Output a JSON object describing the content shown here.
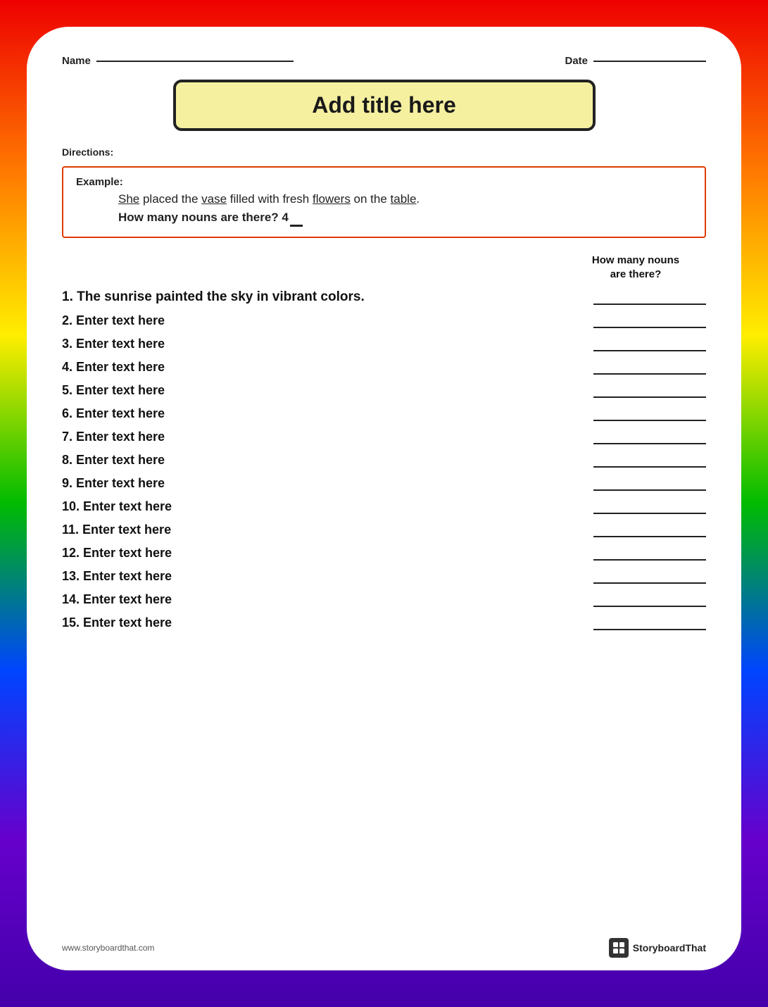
{
  "page": {
    "rainbow_colors": [
      "#dd0000",
      "#ff7700",
      "#ffee00",
      "#00bb00",
      "#0044ff",
      "#7700cc",
      "#440099"
    ],
    "header": {
      "name_label": "Name",
      "date_label": "Date"
    },
    "title": "Add title here",
    "directions_label": "Directions:",
    "example": {
      "label": "Example:",
      "sentence": "She placed the vase filled with fresh flowers on the table.",
      "question": "How many nouns are there? 4"
    },
    "column_header": "How many nouns\nare there?",
    "items": [
      {
        "number": "1.",
        "text": "The sunrise painted the sky in vibrant colors."
      },
      {
        "number": "2.",
        "text": "Enter text here"
      },
      {
        "number": "3.",
        "text": "Enter text here"
      },
      {
        "number": "4.",
        "text": "Enter text here"
      },
      {
        "number": "5.",
        "text": "Enter text here"
      },
      {
        "number": "6.",
        "text": "Enter text here"
      },
      {
        "number": "7.",
        "text": "Enter text here"
      },
      {
        "number": "8.",
        "text": "Enter text here"
      },
      {
        "number": "9.",
        "text": "Enter text here"
      },
      {
        "number": "10.",
        "text": "Enter text here"
      },
      {
        "number": "11.",
        "text": "Enter text here"
      },
      {
        "number": "12.",
        "text": "Enter text here"
      },
      {
        "number": "13.",
        "text": "Enter text here"
      },
      {
        "number": "14.",
        "text": "Enter text here"
      },
      {
        "number": "15.",
        "text": "Enter text here"
      }
    ],
    "footer": {
      "url": "www.storyboardthat.com",
      "logo_text": "StoryboardThat"
    }
  }
}
